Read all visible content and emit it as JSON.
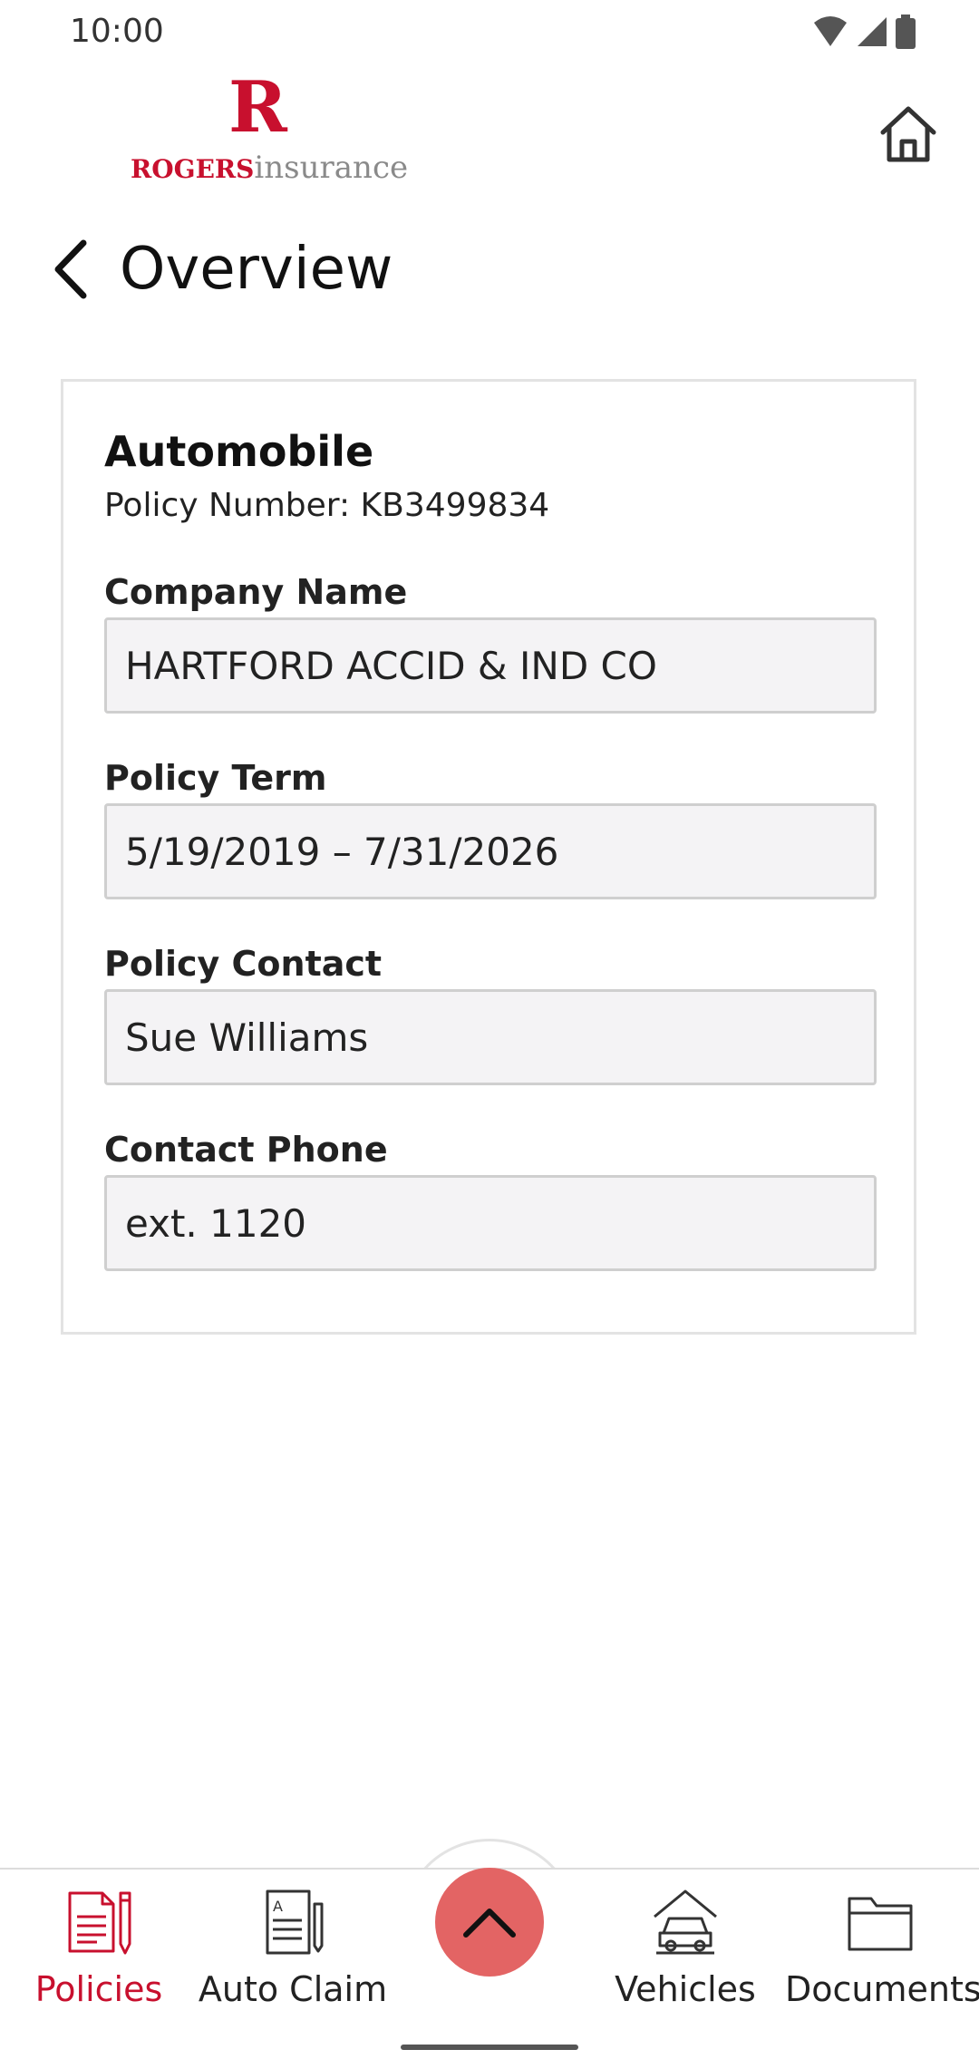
{
  "status_bar": {
    "time": "10:00",
    "icons": [
      "wifi-icon",
      "signal-icon",
      "battery-icon"
    ]
  },
  "header": {
    "logo": {
      "mark": "R",
      "brand_bold": "ROGERS",
      "brand_light": "insurance"
    },
    "home_icon": "home-icon"
  },
  "page": {
    "title": "Overview",
    "back_icon": "chevron-left-icon"
  },
  "policy": {
    "type": "Automobile",
    "number_text": "Policy Number: KB3499834",
    "fields": [
      {
        "label": "Company Name",
        "value": "HARTFORD ACCID & IND CO"
      },
      {
        "label": "Policy Term",
        "value": "5/19/2019 – 7/31/2026"
      },
      {
        "label": "Policy Contact",
        "value": "Sue Williams"
      },
      {
        "label": "Contact Phone",
        "value": "ext. 1120"
      }
    ]
  },
  "bottom_nav": {
    "items": [
      {
        "label": "Policies",
        "icon": "policy-document-icon",
        "active": true
      },
      {
        "label": "Auto Claim",
        "icon": "claim-form-icon",
        "active": false
      },
      {
        "label": "Vehicles",
        "icon": "car-garage-icon",
        "active": false
      },
      {
        "label": "Documents",
        "icon": "folder-icon",
        "active": false
      }
    ],
    "fab_icon": "chevron-up-icon"
  },
  "colors": {
    "brand_red": "#c8102e",
    "fab": "#e36464",
    "field_bg": "#f4f3f5",
    "field_border": "#cfcfcf",
    "card_border": "#e3e3e3"
  }
}
